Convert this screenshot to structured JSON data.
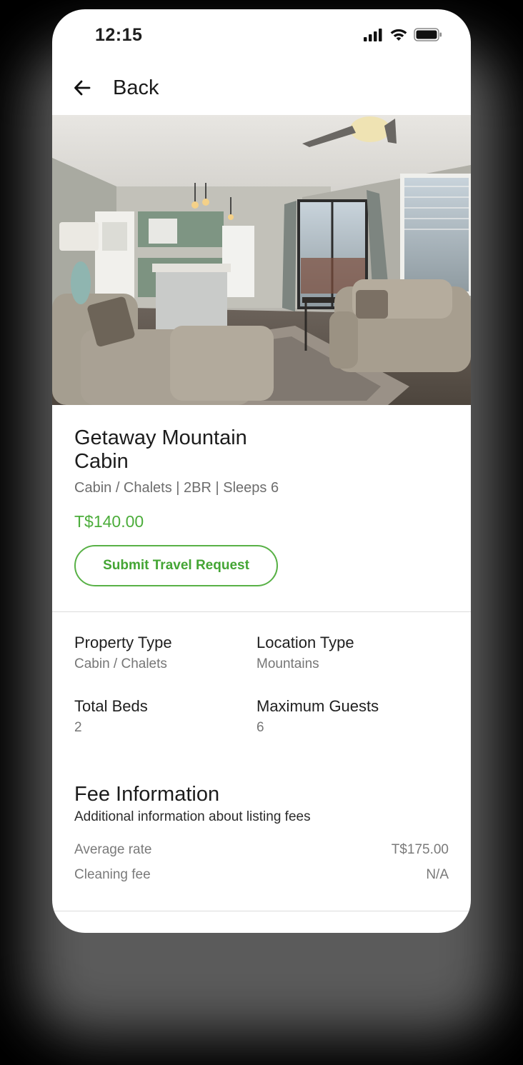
{
  "status_bar": {
    "time": "12:15",
    "icons": [
      "cellular-signal-icon",
      "wifi-icon",
      "battery-icon"
    ]
  },
  "header": {
    "back_icon": "arrow-left-icon",
    "back_label": "Back"
  },
  "listing": {
    "title": "Getaway Mountain Cabin",
    "subtitle": "Cabin / Chalets | 2BR | Sleeps 6",
    "price": "T$140.00",
    "submit_label": "Submit Travel Request"
  },
  "details": [
    {
      "label": "Property Type",
      "value": "Cabin / Chalets"
    },
    {
      "label": "Location Type",
      "value": "Mountains"
    },
    {
      "label": "Total Beds",
      "value": "2"
    },
    {
      "label": "Maximum Guests",
      "value": "6"
    }
  ],
  "fees": {
    "title": "Fee Information",
    "subtitle": "Additional information about listing fees",
    "rows": [
      {
        "label": "Average rate",
        "value": "T$175.00"
      },
      {
        "label": "Cleaning fee",
        "value": "N/A"
      }
    ]
  },
  "colors": {
    "accent": "#4cad3b",
    "text": "#1f1f1f",
    "muted": "#767676",
    "divider": "#dcdcdc",
    "background": "#ffffff"
  }
}
